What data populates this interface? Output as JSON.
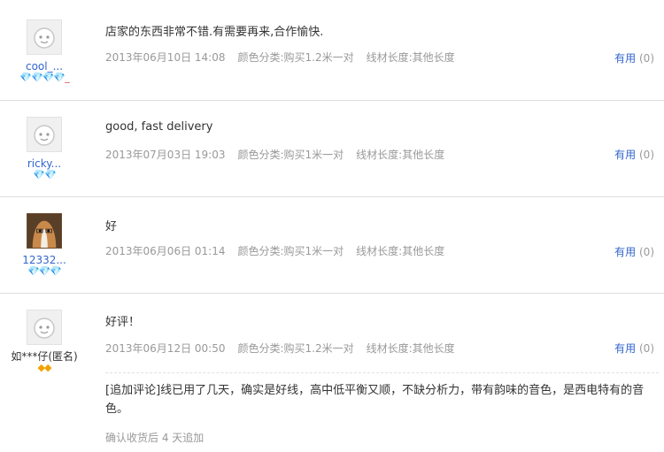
{
  "reviews": [
    {
      "user": "cool_...",
      "rank_icons": "💎💎💎💎_",
      "text": "店家的东西非常不错.有需要再来,合作愉快.",
      "date": "2013年06月10日 14:08",
      "color": "颜色分类:购买1.2米一对",
      "length": "线材长度:其他长度",
      "useful_label": "有用",
      "useful_count": "(0)"
    },
    {
      "user": "ricky...",
      "rank_icons": "💎💎",
      "text": "good, fast delivery",
      "date": "2013年07月03日 19:03",
      "color": "颜色分类:购买1米一对",
      "length": "线材长度:其他长度",
      "useful_label": "有用",
      "useful_count": "(0)"
    },
    {
      "user": "12332...",
      "rank_icons": "💎💎💎",
      "text": "好",
      "date": "2013年06月06日 01:14",
      "color": "颜色分类:购买1米一对",
      "length": "线材长度:其他长度",
      "useful_label": "有用",
      "useful_count": "(0)"
    },
    {
      "user": "如***仔(匿名)",
      "rank_icons": "◆◆",
      "text": "好评！",
      "date": "2013年06月12日 00:50",
      "color": "颜色分类:购买1.2米一对",
      "length": "线材长度:其他长度",
      "useful_label": "有用",
      "useful_count": "(0)",
      "append_text": "[追加评论]线已用了几天，确实是好线，高中低平衡又顺，不缺分析力，带有韵味的音色，是西电特有的音色。",
      "append_note": "确认收货后 4 天追加"
    }
  ],
  "colors": {
    "link": "#3366cc",
    "meta": "#999999",
    "rank_red": "#e4393c",
    "rank_gold": "#f2a300"
  }
}
